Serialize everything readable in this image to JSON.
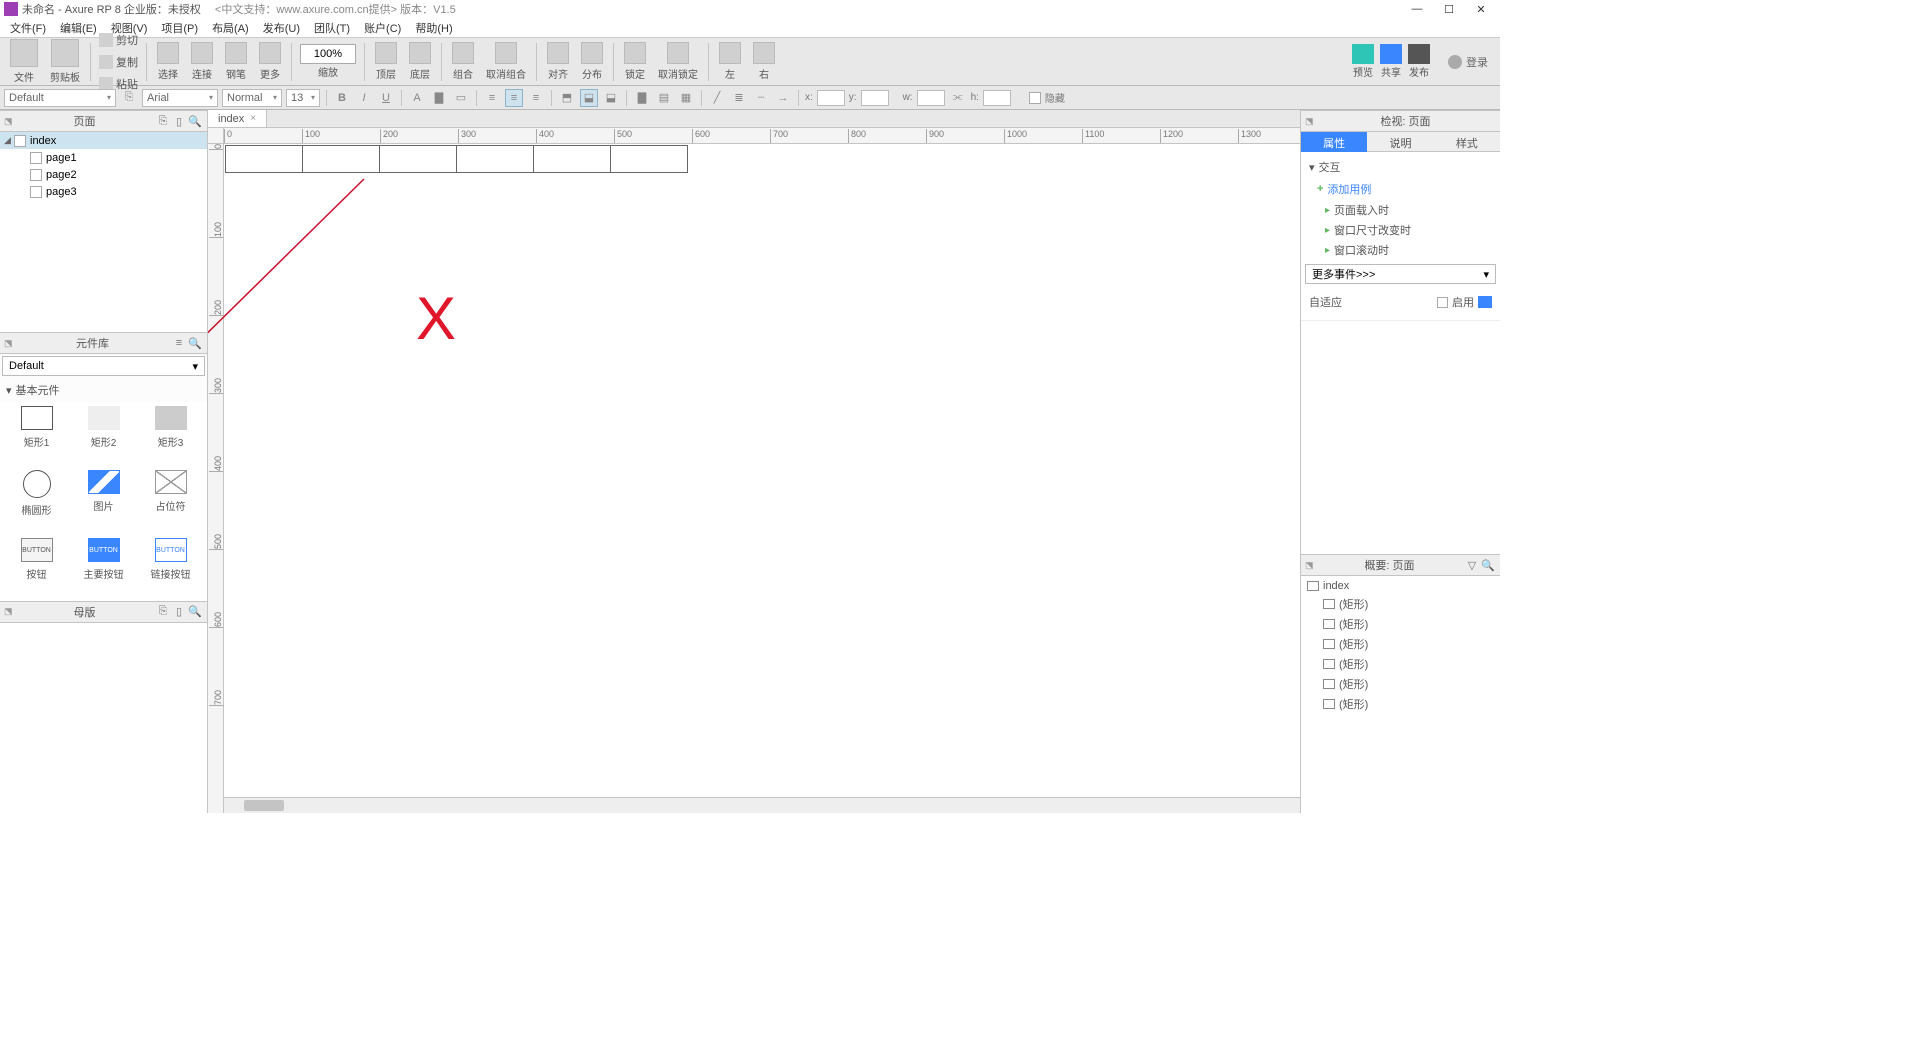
{
  "titlebar": {
    "title": "未命名 - Axure RP 8 企业版：未授权",
    "subtitle": "<中文支持：www.axure.com.cn提供> 版本：V1.5"
  },
  "menu": [
    "文件(F)",
    "编辑(E)",
    "视图(V)",
    "项目(P)",
    "布局(A)",
    "发布(U)",
    "团队(T)",
    "账户(C)",
    "帮助(H)"
  ],
  "toolbar": {
    "file": "文件",
    "clipboard": "剪贴板",
    "cut": "剪切",
    "copy": "复制",
    "paste": "粘贴",
    "select": "选择",
    "connect": "连接",
    "pen": "钢笔",
    "more": "更多",
    "zoom_value": "100%",
    "zoom": "缩放",
    "top": "顶层",
    "bottom": "底层",
    "group": "组合",
    "ungroup": "取消组合",
    "align": "对齐",
    "distribute": "分布",
    "lock": "锁定",
    "unlock": "取消锁定",
    "left": "左",
    "right": "右",
    "preview": "预览",
    "share": "共享",
    "publish": "发布",
    "login": "登录"
  },
  "stylebar": {
    "style_sel": "Default",
    "font": "Arial",
    "weight": "Normal",
    "size": "13",
    "x": "x:",
    "y": "y:",
    "w": "w:",
    "h": "h:",
    "hidden": "隐藏"
  },
  "pages_panel": {
    "title": "页面",
    "items": [
      {
        "name": "index",
        "sel": true
      },
      {
        "name": "page1"
      },
      {
        "name": "page2"
      },
      {
        "name": "page3"
      }
    ]
  },
  "library_panel": {
    "title": "元件库",
    "select": "Default",
    "category": "基本元件",
    "items": [
      "矩形1",
      "矩形2",
      "矩形3",
      "椭圆形",
      "图片",
      "占位符",
      "按钮",
      "主要按钮",
      "链接按钮"
    ],
    "btn_txt": "BUTTON"
  },
  "masters_panel": {
    "title": "母版"
  },
  "canvas": {
    "tab": "index",
    "hticks": [
      "0",
      "100",
      "200",
      "300",
      "400",
      "500",
      "600",
      "700",
      "800",
      "900",
      "1000",
      "1100",
      "1200",
      "1300"
    ],
    "vticks": [
      "0",
      "100",
      "200",
      "300",
      "400",
      "500",
      "600",
      "700"
    ],
    "x_text": "X"
  },
  "inspector_panel": {
    "title": "检视: 页面",
    "tabs": [
      "属性",
      "说明",
      "样式"
    ],
    "section": "交互",
    "add": "添加用例",
    "events": [
      "页面载入时",
      "窗口尺寸改变时",
      "窗口滚动时"
    ],
    "more": "更多事件>>>",
    "adaptive": "自适应",
    "enable": "启用"
  },
  "outline_panel": {
    "title": "概要: 页面",
    "root": "index",
    "items": [
      "(矩形)",
      "(矩形)",
      "(矩形)",
      "(矩形)",
      "(矩形)",
      "(矩形)"
    ]
  }
}
